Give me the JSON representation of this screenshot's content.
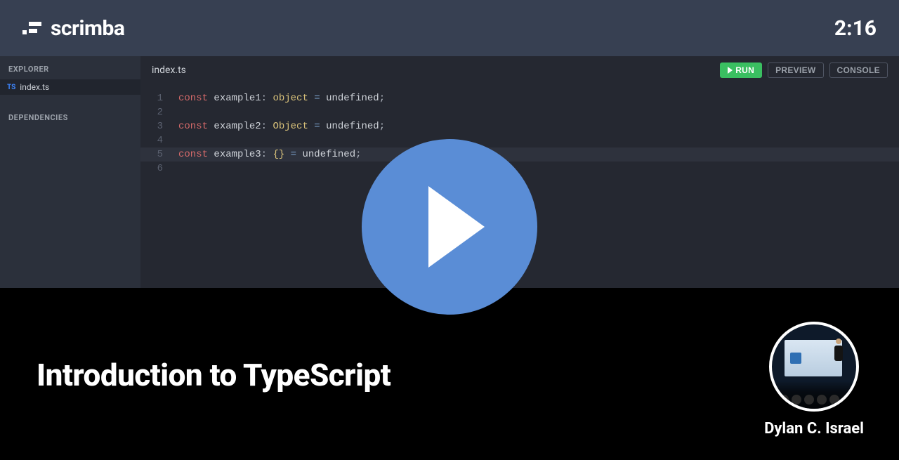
{
  "header": {
    "brand": "scrimba",
    "timer": "2:16"
  },
  "sidebar": {
    "explorer_heading": "EXPLORER",
    "dependencies_heading": "DEPENDENCIES",
    "file_badge": "TS",
    "file_name": "index.ts"
  },
  "editor": {
    "tab_label": "index.ts",
    "buttons": {
      "run": "RUN",
      "preview": "PREVIEW",
      "console": "CONSOLE"
    },
    "code_lines": [
      {
        "n": "1",
        "tokens": [
          [
            "kw",
            "const"
          ],
          [
            "sp",
            " "
          ],
          [
            "id",
            "example1"
          ],
          [
            "punc",
            ":"
          ],
          [
            "sp",
            " "
          ],
          [
            "type",
            "object"
          ],
          [
            "sp",
            " "
          ],
          [
            "op",
            "="
          ],
          [
            "sp",
            " "
          ],
          [
            "val",
            "undefined"
          ],
          [
            "punc",
            ";"
          ]
        ]
      },
      {
        "n": "2",
        "tokens": []
      },
      {
        "n": "3",
        "tokens": [
          [
            "kw",
            "const"
          ],
          [
            "sp",
            " "
          ],
          [
            "id",
            "example2"
          ],
          [
            "punc",
            ":"
          ],
          [
            "sp",
            " "
          ],
          [
            "type",
            "Object"
          ],
          [
            "sp",
            " "
          ],
          [
            "op",
            "="
          ],
          [
            "sp",
            " "
          ],
          [
            "val",
            "undefined"
          ],
          [
            "punc",
            ";"
          ]
        ]
      },
      {
        "n": "4",
        "tokens": []
      },
      {
        "n": "5",
        "hl": true,
        "tokens": [
          [
            "kw",
            "const"
          ],
          [
            "sp",
            " "
          ],
          [
            "id",
            "example3"
          ],
          [
            "punc",
            ":"
          ],
          [
            "sp",
            " "
          ],
          [
            "type",
            "{}"
          ],
          [
            "sp",
            " "
          ],
          [
            "op",
            "="
          ],
          [
            "sp",
            " "
          ],
          [
            "val",
            "undefined"
          ],
          [
            "punc",
            ";"
          ]
        ]
      },
      {
        "n": "6",
        "tokens": []
      }
    ]
  },
  "course": {
    "title": "Introduction to TypeScript",
    "author": "Dylan C. Israel"
  }
}
